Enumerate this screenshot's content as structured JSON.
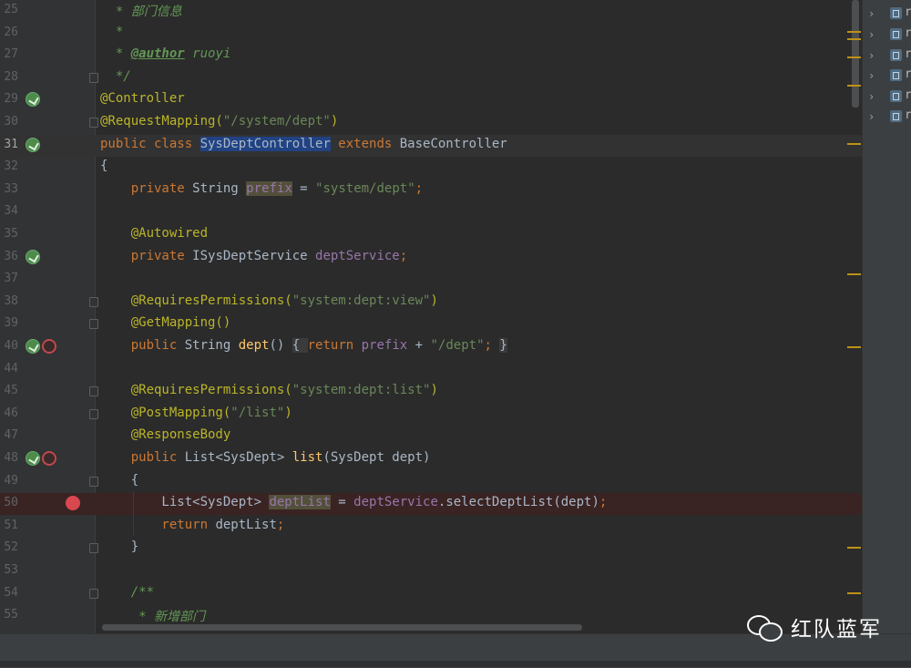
{
  "editor": {
    "lines": [
      {
        "n": "25",
        "segs": [
          [
            "cmt",
            "  * 部门信息"
          ]
        ]
      },
      {
        "n": "26",
        "segs": [
          [
            "cmt",
            "  *"
          ]
        ]
      },
      {
        "n": "27",
        "segs": [
          [
            "cmt",
            "  * "
          ],
          [
            "tag",
            "@author"
          ],
          [
            "cmt",
            " ruoyi"
          ]
        ]
      },
      {
        "n": "28",
        "segs": [
          [
            "cmt",
            "  */"
          ]
        ]
      },
      {
        "n": "29",
        "segs": [
          [
            "ann",
            "@Controller"
          ]
        ]
      },
      {
        "n": "30",
        "segs": [
          [
            "ann",
            "@RequestMapping("
          ],
          [
            "str",
            "\"/system/dept\""
          ],
          [
            "ann",
            ")"
          ]
        ]
      },
      {
        "n": "31",
        "segs": [
          [
            "kw",
            "public class "
          ],
          [
            "sel",
            "SysDeptController"
          ],
          [
            "kw",
            " extends "
          ],
          [
            "plain",
            "BaseController"
          ]
        ]
      },
      {
        "n": "32",
        "segs": [
          [
            "plain",
            "{"
          ]
        ]
      },
      {
        "n": "33",
        "segs": [
          [
            "kw",
            "    private "
          ],
          [
            "plain",
            "String "
          ],
          [
            "hl",
            "prefix"
          ],
          [
            "plain",
            " = "
          ],
          [
            "str",
            "\"system/dept\""
          ],
          [
            "kw",
            ";"
          ]
        ]
      },
      {
        "n": "34",
        "segs": []
      },
      {
        "n": "35",
        "segs": [
          [
            "ann",
            "    @Autowired"
          ]
        ]
      },
      {
        "n": "36",
        "segs": [
          [
            "kw",
            "    private "
          ],
          [
            "plain",
            "ISysDeptService "
          ],
          [
            "fld",
            "deptService"
          ],
          [
            "kw",
            ";"
          ]
        ]
      },
      {
        "n": "37",
        "segs": []
      },
      {
        "n": "38",
        "segs": [
          [
            "ann",
            "    @RequiresPermissions("
          ],
          [
            "str",
            "\"system:dept:view\""
          ],
          [
            "ann",
            ")"
          ]
        ]
      },
      {
        "n": "39",
        "segs": [
          [
            "ann",
            "    @GetMapping()"
          ]
        ]
      },
      {
        "n": "40",
        "segs": [
          [
            "kw",
            "    public "
          ],
          [
            "plain",
            "String "
          ],
          [
            "mth",
            "dept"
          ],
          [
            "plain",
            "() "
          ],
          [
            "fold",
            "{ "
          ],
          [
            "kw",
            "return "
          ],
          [
            "fld",
            "prefix"
          ],
          [
            "plain",
            " + "
          ],
          [
            "str",
            "\"/dept\""
          ],
          [
            "kw",
            "; "
          ],
          [
            "fold",
            "}"
          ]
        ]
      },
      {
        "n": "44",
        "segs": []
      },
      {
        "n": "45",
        "segs": [
          [
            "ann",
            "    @RequiresPermissions("
          ],
          [
            "str",
            "\"system:dept:list\""
          ],
          [
            "ann",
            ")"
          ]
        ]
      },
      {
        "n": "46",
        "segs": [
          [
            "ann",
            "    @PostMapping("
          ],
          [
            "str",
            "\"/list\""
          ],
          [
            "ann",
            ")"
          ]
        ]
      },
      {
        "n": "47",
        "segs": [
          [
            "ann",
            "    @ResponseBody"
          ]
        ]
      },
      {
        "n": "48",
        "segs": [
          [
            "kw",
            "    public "
          ],
          [
            "plain",
            "List<SysDept> "
          ],
          [
            "mth",
            "list"
          ],
          [
            "plain",
            "(SysDept dept)"
          ]
        ]
      },
      {
        "n": "49",
        "segs": [
          [
            "plain",
            "    {"
          ]
        ]
      },
      {
        "n": "50",
        "segs": [
          [
            "plain",
            "        List<SysDept> "
          ],
          [
            "hl",
            "deptList"
          ],
          [
            "plain",
            " = "
          ],
          [
            "fld",
            "deptService"
          ],
          [
            "plain",
            ".selectDeptList(dept)"
          ],
          [
            "kw",
            ";"
          ]
        ]
      },
      {
        "n": "51",
        "segs": [
          [
            "kw",
            "        return "
          ],
          [
            "plain",
            "deptList"
          ],
          [
            "kw",
            ";"
          ]
        ]
      },
      {
        "n": "52",
        "segs": [
          [
            "plain",
            "    }"
          ]
        ]
      },
      {
        "n": "53",
        "segs": []
      },
      {
        "n": "54",
        "segs": [
          [
            "cmt",
            "    /**"
          ]
        ]
      },
      {
        "n": "55",
        "segs": [
          [
            "cmt",
            "     * 新增部门"
          ]
        ]
      }
    ]
  },
  "project_tree": {
    "items": [
      {
        "label": "r"
      },
      {
        "label": "r"
      },
      {
        "label": "r"
      },
      {
        "label": "r"
      },
      {
        "label": "r"
      },
      {
        "label": "r"
      }
    ]
  },
  "watermark": {
    "text": "红队蓝军"
  },
  "colors": {
    "background": "#2b2b2b",
    "keyword": "#cc7832",
    "annotation": "#bbb529",
    "string": "#6a8759",
    "field": "#9876aa",
    "method": "#ffc66d",
    "comment": "#629755"
  }
}
